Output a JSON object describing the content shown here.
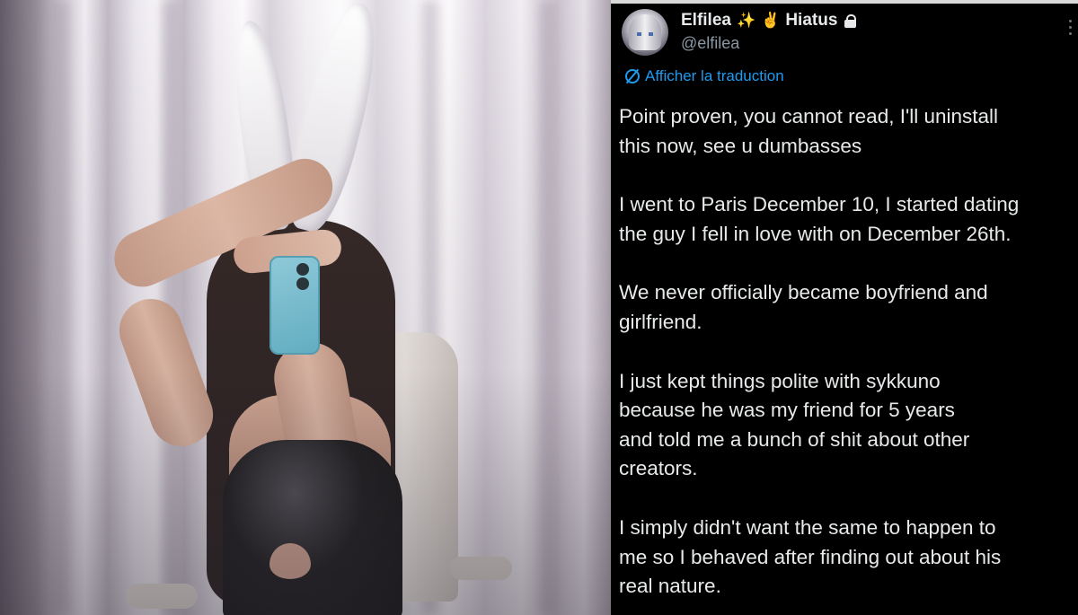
{
  "photo": {
    "icon": "bunny-cosplay-mirror-selfie"
  },
  "tweet": {
    "display_name": "Elfilea",
    "name_icons": [
      "sparkles-icon",
      "hand-icon"
    ],
    "status_text": "Hiatus",
    "handle": "@elfilea",
    "translate_label": "Afficher la traduction",
    "paragraphs": [
      [
        "Point proven, you cannot read, I'll uninstall",
        "this now, see u dumbasses"
      ],
      [
        "I went to Paris December 10, I started dating",
        "the guy I fell in love with on December 26th."
      ],
      [
        "We never officially became boyfriend and",
        "girlfriend."
      ],
      [
        "I just kept things polite with sykkuno",
        "because he was my friend for 5 years",
        "and told me a bunch of shit about other",
        "creators."
      ],
      [
        "I simply didn't want the same to happen to",
        "me so I behaved after finding out about his",
        "real nature."
      ]
    ]
  },
  "colors": {
    "background": "#000000",
    "text": "#e7e9ea",
    "handle": "#8b98a5",
    "link": "#1d9bf0"
  }
}
